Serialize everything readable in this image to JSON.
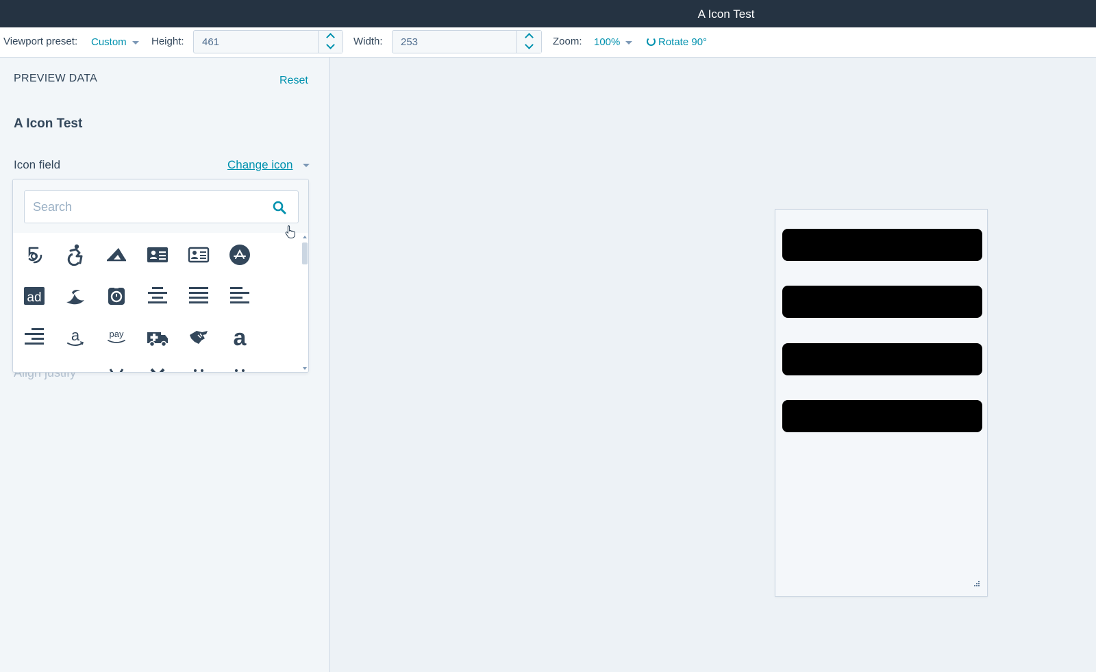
{
  "window": {
    "title": "A Icon Test"
  },
  "toolbar": {
    "viewport_label": "Viewport preset:",
    "viewport_value": "Custom",
    "height_label": "Height:",
    "height_value": "461",
    "width_label": "Width:",
    "width_value": "253",
    "zoom_label": "Zoom:",
    "zoom_value": "100%",
    "rotate_label": "Rotate 90°"
  },
  "sidebar": {
    "heading": "PREVIEW DATA",
    "reset_label": "Reset",
    "module_title": "A Icon Test",
    "field_label": "Icon field",
    "change_icon_label": "Change icon",
    "below_text": "Align justify"
  },
  "icon_picker": {
    "search_placeholder": "Search",
    "icons": [
      "500px-icon",
      "accessible-icon",
      "accusoft-icon",
      "address-card-icon",
      "address-card-outline-icon",
      "app-store-circle-icon",
      "ad-icon",
      "adversal-icon",
      "affiliatetheme-icon",
      "align-center-icon",
      "align-justify-icon",
      "align-left-icon",
      "align-right-icon",
      "amazon-icon",
      "amazon-pay-icon",
      "ambulance-icon",
      "american-sign-language-icon",
      "a-letter-icon"
    ]
  },
  "preview": {
    "redacted_rows": 4
  },
  "colors": {
    "accent": "#0091ae",
    "titlebar": "#253342",
    "text": "#33475b",
    "icon": "#33475b"
  }
}
